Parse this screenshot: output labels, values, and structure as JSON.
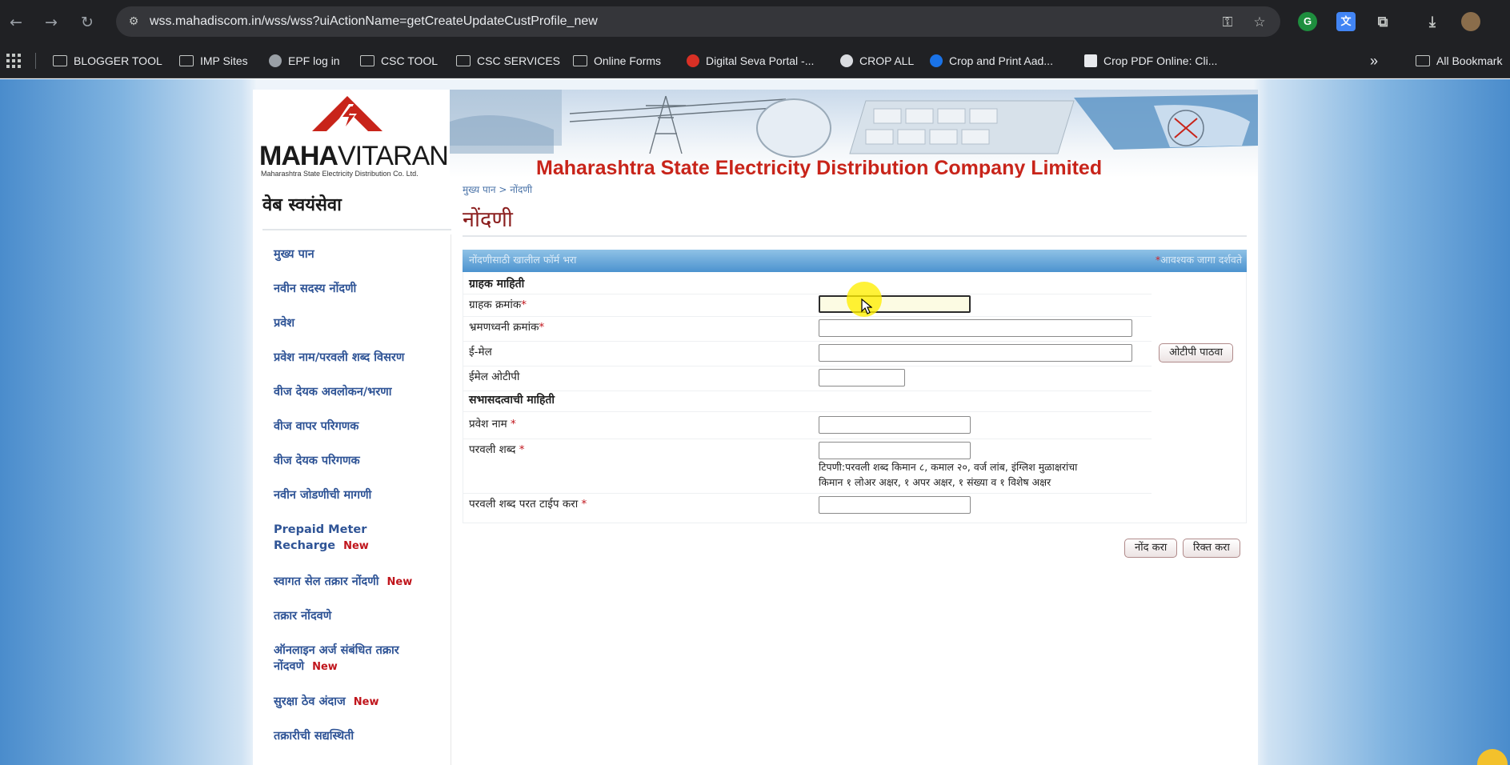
{
  "browser": {
    "url": "wss.mahadiscom.in/wss/wss?uiActionName=getCreateUpdateCustProfile_new",
    "bookmarks": [
      {
        "label": "BLOGGER TOOL",
        "icon": "folder-icon"
      },
      {
        "label": "IMP Sites",
        "icon": "folder-icon"
      },
      {
        "label": "EPF log in",
        "icon": "globe-icon"
      },
      {
        "label": "CSC TOOL",
        "icon": "folder-icon"
      },
      {
        "label": "CSC SERVICES",
        "icon": "folder-icon"
      },
      {
        "label": "Online Forms",
        "icon": "folder-icon"
      },
      {
        "label": "Digital Seva Portal -...",
        "icon": "site-favicon"
      },
      {
        "label": "CROP ALL",
        "icon": "site-favicon"
      },
      {
        "label": "Crop and Print Aad...",
        "icon": "site-favicon"
      },
      {
        "label": "Crop PDF Online: Cli...",
        "icon": "site-favicon"
      }
    ],
    "overflow_label": "»",
    "all_bookmarks_label": "All Bookmark"
  },
  "header": {
    "logo_bold": "MAHA",
    "logo_light": "VITARAN",
    "logo_subtitle": "Maharashtra State Electricity Distribution Co. Ltd.",
    "company_name": "Maharashtra State Electricity Distribution Company Limited",
    "site_title": "वेब स्वयंसेवा"
  },
  "breadcrumb": "मुख्य पान > नोंदणी",
  "page_title": "नोंदणी",
  "sidebar": {
    "items": [
      {
        "label": "मुख्य पान",
        "new": ""
      },
      {
        "label": "नवीन सदस्य नोंदणी",
        "new": ""
      },
      {
        "label": "प्रवेश",
        "new": ""
      },
      {
        "label": "प्रवेश नाम/परवली शब्द विसरण",
        "new": ""
      },
      {
        "label": "वीज देयक अवलोकन/भरणा",
        "new": ""
      },
      {
        "label": "वीज वापर परिगणक",
        "new": ""
      },
      {
        "label": "वीज देयक परिगणक",
        "new": ""
      },
      {
        "label": "नवीन जोडणीची मागणी",
        "new": ""
      },
      {
        "label": "Prepaid Meter",
        "label2": "Recharge",
        "new": "New"
      },
      {
        "label": "स्वागत सेल तक्रार नोंदणी",
        "new": "New"
      },
      {
        "label": "तक्रार नोंदवणे",
        "new": ""
      },
      {
        "label": "ऑनलाइन अर्ज संबंधित तक्रार",
        "label2": "नोंदवणे",
        "new": "New"
      },
      {
        "label": "सुरक्षा ठेव अंदाज",
        "new": "New"
      },
      {
        "label": "तक्रारीची सद्यस्थिती",
        "new": ""
      }
    ]
  },
  "form": {
    "header_left": "नोंदणीसाठी खालील फॉर्म भरा",
    "header_required_mark": "*",
    "header_right": "आवश्यक जागा दर्शवते",
    "section_customer": "ग्राहक माहिती",
    "section_member": "सभासदत्वाची माहिती",
    "required_mark": "*",
    "fields": {
      "consumer_number": {
        "label": "ग्राहक क्रमांक",
        "value": ""
      },
      "mobile_number": {
        "label": "भ्रमणध्वनी क्रमांक",
        "value": ""
      },
      "email": {
        "label": "ई-मेल",
        "value": ""
      },
      "email_otp": {
        "label": "ईमेल ओटीपी",
        "value": ""
      },
      "login_name": {
        "label": "प्रवेश नाम ",
        "value": ""
      },
      "password": {
        "label": "परवली शब्द ",
        "value": ""
      },
      "password_retype": {
        "label": "परवली शब्द परत टाईप करा ",
        "value": ""
      }
    },
    "password_note_line1": "टिपणी:परवली शब्द किमान ८, कमाल २०, वर्ज लांब, इंग्लिश मुळाक्षरांचा",
    "password_note_line2": "किमान १ लोअर अक्षर, १ अपर अक्षर, १ संख्या व १ विशेष अक्षर",
    "send_otp_button": "ओटीपी पाठवा",
    "register_button": "नोंद करा",
    "clear_button": "रिक्त करा"
  },
  "colors": {
    "accent_red": "#c8241a",
    "nav_blue": "#2f5496",
    "title_maroon": "#8b1f1f",
    "form_header_blue": "#4c93cf"
  }
}
